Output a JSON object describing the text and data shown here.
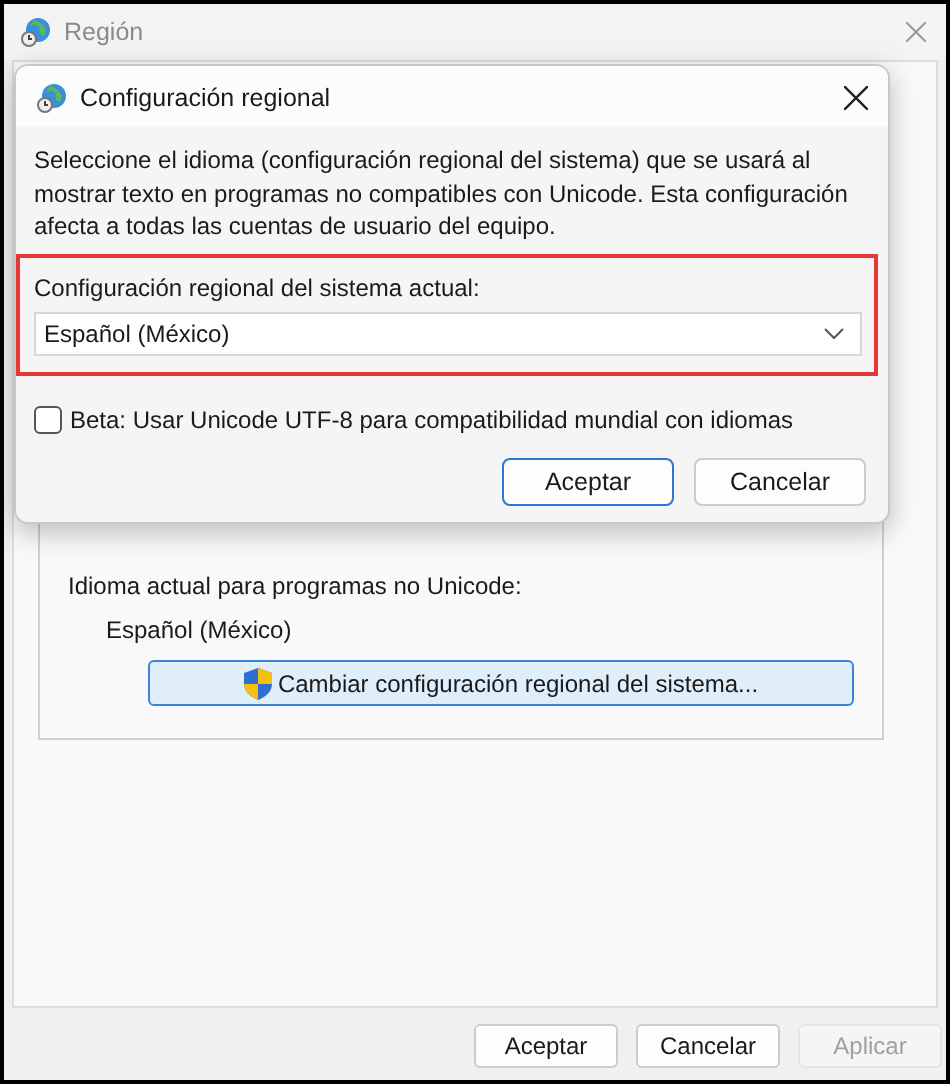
{
  "window": {
    "title": "Región"
  },
  "background": {
    "current_label": "Idioma actual para programas no Unicode:",
    "current_value": "Español (México)",
    "change_button": "Cambiar configuración regional del sistema..."
  },
  "dialog": {
    "title": "Configuración regional",
    "description": "Seleccione el idioma (configuración regional del sistema) que se usará al mostrar texto en programas no compatibles con Unicode. Esta configuración afecta a todas las cuentas de usuario del equipo.",
    "locale_label": "Configuración regional del sistema actual:",
    "locale_value": "Español (México)",
    "highlighted": true,
    "beta_checkbox": {
      "label": "Beta: Usar Unicode UTF-8 para compatibilidad mundial con idiomas",
      "checked": false
    },
    "buttons": [
      {
        "label": "Aceptar",
        "default": true
      },
      {
        "label": "Cancelar",
        "default": false
      }
    ]
  },
  "buttons": [
    {
      "label": "Aceptar",
      "disabled": false
    },
    {
      "label": "Cancelar",
      "disabled": false
    },
    {
      "label": "Aplicar",
      "disabled": true
    }
  ]
}
